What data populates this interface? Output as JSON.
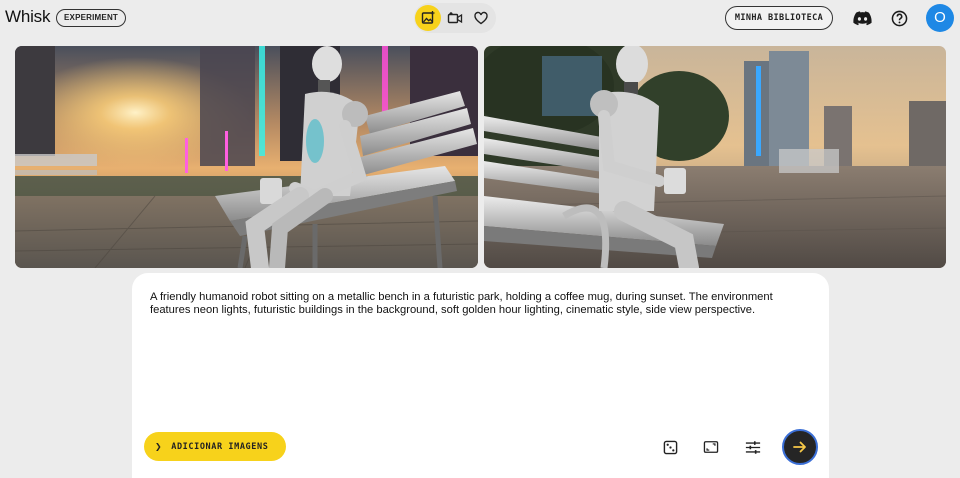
{
  "header": {
    "app_title": "Whisk",
    "badge": "EXPERIMENT",
    "modes": [
      "image-mode-icon",
      "video-mode-icon",
      "favorites-icon"
    ],
    "library_button": "MINHA BIBLIOTECA",
    "avatar_initial": "O",
    "accent": "#f7d21b",
    "avatar_color": "#1e88e5"
  },
  "gallery": {
    "images": [
      {
        "name": "generated-image-1",
        "subject": "robot on bench at sunset, neon city"
      },
      {
        "name": "generated-image-2",
        "subject": "robot on bench, side view, golden hour"
      }
    ]
  },
  "prompt": {
    "text": "A friendly humanoid robot sitting on a metallic bench in a futuristic park, holding a coffee mug, during sunset. The environment features neon lights, futuristic buildings in the background, soft golden hour lighting, cinematic style, side view perspective.",
    "add_images_label": "ADICIONAR IMAGENS",
    "tools": [
      "dice-icon",
      "aspect-ratio-icon",
      "settings-sliders-icon"
    ],
    "submit": "arrow-right-icon"
  }
}
